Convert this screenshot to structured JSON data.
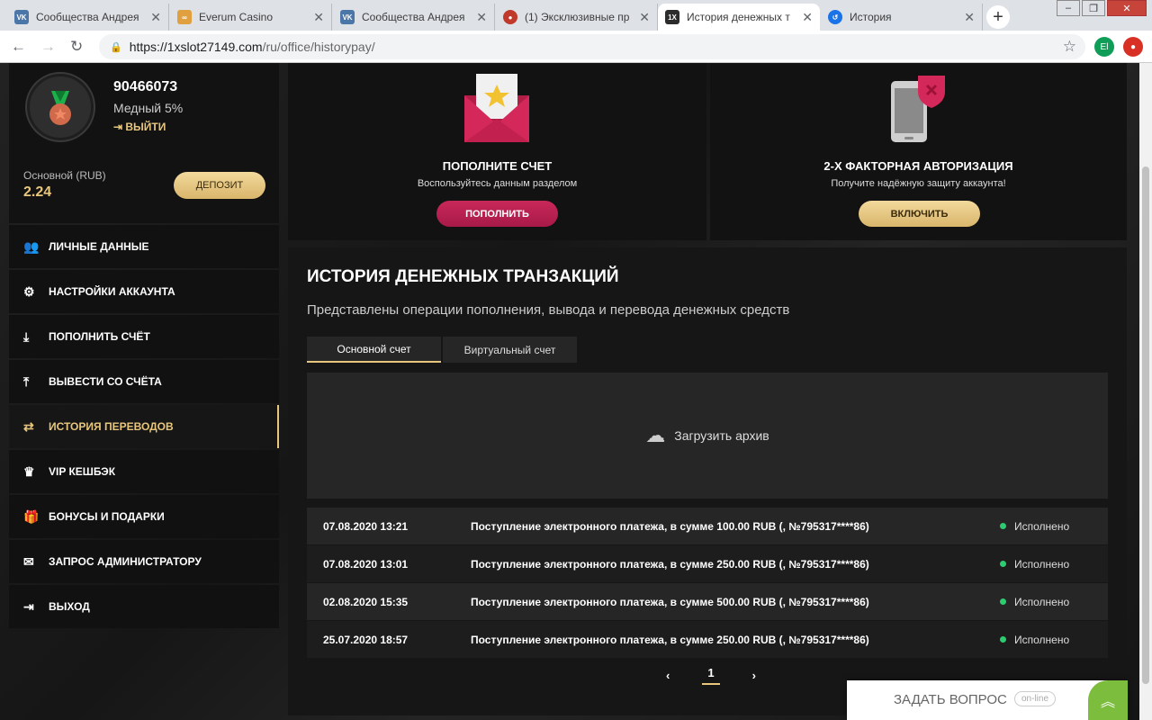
{
  "browser": {
    "tabs": [
      {
        "title": "Сообщества Андрея",
        "icon": "vk-icon",
        "color": "#4a76a8"
      },
      {
        "title": "Everum Casino",
        "icon": "everum-icon",
        "color": "#e0a040"
      },
      {
        "title": "Сообщества Андрея",
        "icon": "vk-icon",
        "color": "#4a76a8"
      },
      {
        "title": "(1) Эксклюзивные пр",
        "icon": "chip-icon",
        "color": "#c0392b"
      },
      {
        "title": "История денежных т",
        "icon": "1x-icon",
        "color": "#2c2c2c"
      },
      {
        "title": "История",
        "icon": "history-icon",
        "color": "#1a73e8"
      }
    ],
    "url_host": "https://1xslot27149.com",
    "url_path": "/ru/office/historypay/",
    "profile_initials": "El"
  },
  "user": {
    "id": "90466073",
    "rank": "Медный 5%",
    "logout": "ВЫЙТИ",
    "balance_label": "Основной (RUB)",
    "balance": "2.24",
    "deposit": "ДЕПОЗИТ"
  },
  "menu": [
    {
      "label": "ЛИЧНЫЕ ДАННЫЕ",
      "icon": "users-icon",
      "glyph": "👥"
    },
    {
      "label": "НАСТРОЙКИ АККАУНТА",
      "icon": "gears-icon",
      "glyph": "⚙"
    },
    {
      "label": "ПОПОЛНИТЬ СЧЁТ",
      "icon": "download-icon",
      "glyph": "⤓"
    },
    {
      "label": "ВЫВЕСТИ СО СЧЁТА",
      "icon": "upload-icon",
      "glyph": "⤒"
    },
    {
      "label": "ИСТОРИЯ ПЕРЕВОДОВ",
      "icon": "transfer-icon",
      "glyph": "⇄",
      "active": true
    },
    {
      "label": "VIP КЕШБЭК",
      "icon": "crown-icon",
      "glyph": "♛"
    },
    {
      "label": "БОНУСЫ И ПОДАРКИ",
      "icon": "gift-icon",
      "glyph": "🎁"
    },
    {
      "label": "ЗАПРОС АДМИНИСТРАТОРУ",
      "icon": "mail-icon",
      "glyph": "✉"
    },
    {
      "label": "ВЫХОД",
      "icon": "exit-icon",
      "glyph": "⇥"
    }
  ],
  "promo": {
    "deposit": {
      "title": "ПОПОЛНИТЕ СЧЕТ",
      "sub": "Воспользуйтесь данным разделом",
      "button": "ПОПОЛНИТЬ"
    },
    "twofa": {
      "title": "2-Х ФАКТОРНАЯ АВТОРИЗАЦИЯ",
      "sub": "Получите надёжную защиту аккаунта!",
      "button": "ВКЛЮЧИТЬ"
    }
  },
  "history": {
    "title": "ИСТОРИЯ ДЕНЕЖНЫХ ТРАНЗАКЦИЙ",
    "subtitle": "Представлены операции пополнения, вывода и перевода денежных средств",
    "tabs": [
      "Основной счет",
      "Виртуальный счет"
    ],
    "archive": "Загрузить архив",
    "rows": [
      {
        "date": "07.08.2020 13:21",
        "desc": "Поступление электронного платежа, в сумме 100.00 RUB (, №795317****86)",
        "status": "Исполнено"
      },
      {
        "date": "07.08.2020 13:01",
        "desc": "Поступление электронного платежа, в сумме 250.00 RUB (, №795317****86)",
        "status": "Исполнено"
      },
      {
        "date": "02.08.2020 15:35",
        "desc": "Поступление электронного платежа, в сумме 500.00 RUB (, №795317****86)",
        "status": "Исполнено"
      },
      {
        "date": "25.07.2020 18:57",
        "desc": "Поступление электронного платежа, в сумме 250.00 RUB (, №795317****86)",
        "status": "Исполнено"
      }
    ],
    "page": "1"
  },
  "chat": {
    "label": "ЗАДАТЬ ВОПРОС",
    "status": "on-line"
  }
}
